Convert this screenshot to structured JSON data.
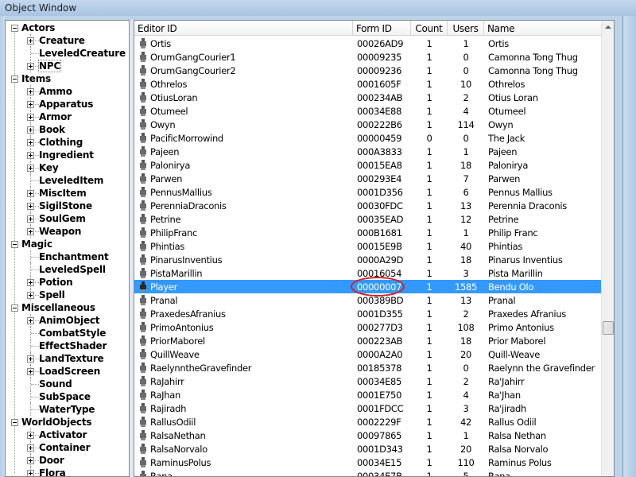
{
  "window": {
    "title": "Object Window"
  },
  "tree": [
    {
      "label": "Actors",
      "level": 0,
      "expander": "minus"
    },
    {
      "label": "Creature",
      "level": 1,
      "expander": "plus"
    },
    {
      "label": "LeveledCreature",
      "level": 1,
      "expander": "none"
    },
    {
      "label": "NPC",
      "level": 1,
      "expander": "plus",
      "selected": true
    },
    {
      "label": "Items",
      "level": 0,
      "expander": "minus"
    },
    {
      "label": "Ammo",
      "level": 1,
      "expander": "plus"
    },
    {
      "label": "Apparatus",
      "level": 1,
      "expander": "plus"
    },
    {
      "label": "Armor",
      "level": 1,
      "expander": "plus"
    },
    {
      "label": "Book",
      "level": 1,
      "expander": "plus"
    },
    {
      "label": "Clothing",
      "level": 1,
      "expander": "plus"
    },
    {
      "label": "Ingredient",
      "level": 1,
      "expander": "plus"
    },
    {
      "label": "Key",
      "level": 1,
      "expander": "plus"
    },
    {
      "label": "LeveledItem",
      "level": 1,
      "expander": "none"
    },
    {
      "label": "MiscItem",
      "level": 1,
      "expander": "plus"
    },
    {
      "label": "SigilStone",
      "level": 1,
      "expander": "plus"
    },
    {
      "label": "SoulGem",
      "level": 1,
      "expander": "plus"
    },
    {
      "label": "Weapon",
      "level": 1,
      "expander": "plus"
    },
    {
      "label": "Magic",
      "level": 0,
      "expander": "minus"
    },
    {
      "label": "Enchantment",
      "level": 1,
      "expander": "none"
    },
    {
      "label": "LeveledSpell",
      "level": 1,
      "expander": "none"
    },
    {
      "label": "Potion",
      "level": 1,
      "expander": "plus"
    },
    {
      "label": "Spell",
      "level": 1,
      "expander": "plus"
    },
    {
      "label": "Miscellaneous",
      "level": 0,
      "expander": "minus"
    },
    {
      "label": "AnimObject",
      "level": 1,
      "expander": "plus"
    },
    {
      "label": "CombatStyle",
      "level": 1,
      "expander": "none"
    },
    {
      "label": "EffectShader",
      "level": 1,
      "expander": "none"
    },
    {
      "label": "LandTexture",
      "level": 1,
      "expander": "plus"
    },
    {
      "label": "LoadScreen",
      "level": 1,
      "expander": "plus"
    },
    {
      "label": "Sound",
      "level": 1,
      "expander": "none"
    },
    {
      "label": "SubSpace",
      "level": 1,
      "expander": "none"
    },
    {
      "label": "WaterType",
      "level": 1,
      "expander": "none"
    },
    {
      "label": "WorldObjects",
      "level": 0,
      "expander": "minus"
    },
    {
      "label": "Activator",
      "level": 1,
      "expander": "plus"
    },
    {
      "label": "Container",
      "level": 1,
      "expander": "plus"
    },
    {
      "label": "Door",
      "level": 1,
      "expander": "plus"
    },
    {
      "label": "Flora",
      "level": 1,
      "expander": "plus"
    }
  ],
  "list": {
    "columns": [
      "Editor ID",
      "Form ID",
      "Count",
      "Users",
      "Name"
    ],
    "rows": [
      {
        "editor_id": "Ortis",
        "form_id": "00026AD9",
        "count": "1",
        "users": "1",
        "name": "Ortis"
      },
      {
        "editor_id": "OrumGangCourier1",
        "form_id": "00009235",
        "count": "1",
        "users": "0",
        "name": "Camonna Tong Thug"
      },
      {
        "editor_id": "OrumGangCourier2",
        "form_id": "00009236",
        "count": "1",
        "users": "0",
        "name": "Camonna Tong Thug"
      },
      {
        "editor_id": "Othrelos",
        "form_id": "0001605F",
        "count": "1",
        "users": "10",
        "name": "Othrelos"
      },
      {
        "editor_id": "OtiusLoran",
        "form_id": "000234AB",
        "count": "1",
        "users": "2",
        "name": "Otius Loran"
      },
      {
        "editor_id": "Otumeel",
        "form_id": "00034E88",
        "count": "1",
        "users": "4",
        "name": "Otumeel"
      },
      {
        "editor_id": "Owyn",
        "form_id": "000222B6",
        "count": "1",
        "users": "114",
        "name": "Owyn"
      },
      {
        "editor_id": "PacificMorrowind",
        "form_id": "00000459",
        "count": "0",
        "users": "0",
        "name": "The Jack"
      },
      {
        "editor_id": "Pajeen",
        "form_id": "000A3833",
        "count": "1",
        "users": "1",
        "name": "Pajeen"
      },
      {
        "editor_id": "Palonirya",
        "form_id": "00015EA8",
        "count": "1",
        "users": "18",
        "name": "Palonirya"
      },
      {
        "editor_id": "Parwen",
        "form_id": "000293E4",
        "count": "1",
        "users": "7",
        "name": "Parwen"
      },
      {
        "editor_id": "PennusMallius",
        "form_id": "0001D356",
        "count": "1",
        "users": "6",
        "name": "Pennus Mallius"
      },
      {
        "editor_id": "PerenniaDraconis",
        "form_id": "00030FDC",
        "count": "1",
        "users": "13",
        "name": "Perennia Draconis"
      },
      {
        "editor_id": "Petrine",
        "form_id": "00035EAD",
        "count": "1",
        "users": "12",
        "name": "Petrine"
      },
      {
        "editor_id": "PhilipFranc",
        "form_id": "000B1681",
        "count": "1",
        "users": "1",
        "name": "Philip Franc"
      },
      {
        "editor_id": "Phintias",
        "form_id": "00015E9B",
        "count": "1",
        "users": "40",
        "name": "Phintias"
      },
      {
        "editor_id": "PinarusInventius",
        "form_id": "0000A29D",
        "count": "1",
        "users": "18",
        "name": "Pinarus Inventius"
      },
      {
        "editor_id": "PistaMarillin",
        "form_id": "00016054",
        "count": "1",
        "users": "3",
        "name": "Pista Marillin"
      },
      {
        "editor_id": "Player",
        "form_id": "00000007",
        "count": "1",
        "users": "1585",
        "name": "Bendu Olo",
        "selected": true
      },
      {
        "editor_id": "Pranal",
        "form_id": "000389BD",
        "count": "1",
        "users": "13",
        "name": "Pranal"
      },
      {
        "editor_id": "PraxedesAfranius",
        "form_id": "0001D355",
        "count": "1",
        "users": "2",
        "name": "Praxedes Afranius"
      },
      {
        "editor_id": "PrimoAntonius",
        "form_id": "000277D3",
        "count": "1",
        "users": "108",
        "name": "Primo Antonius"
      },
      {
        "editor_id": "PriorMaborel",
        "form_id": "000223AB",
        "count": "1",
        "users": "18",
        "name": "Prior Maborel"
      },
      {
        "editor_id": "QuillWeave",
        "form_id": "0000A2A0",
        "count": "1",
        "users": "20",
        "name": "Quill-Weave"
      },
      {
        "editor_id": "RaelynntheGravefinder",
        "form_id": "00185378",
        "count": "1",
        "users": "0",
        "name": "Raelynn the Gravefinder"
      },
      {
        "editor_id": "RaJahirr",
        "form_id": "00034E85",
        "count": "1",
        "users": "2",
        "name": "Ra'Jahirr"
      },
      {
        "editor_id": "RaJhan",
        "form_id": "0001E750",
        "count": "1",
        "users": "4",
        "name": "Ra'Jhan"
      },
      {
        "editor_id": "Rajiradh",
        "form_id": "0001FDCC",
        "count": "1",
        "users": "3",
        "name": "Ra'jiradh"
      },
      {
        "editor_id": "RallusOdiil",
        "form_id": "0002229F",
        "count": "1",
        "users": "42",
        "name": "Rallus Odiil"
      },
      {
        "editor_id": "RalsaNethan",
        "form_id": "00097865",
        "count": "1",
        "users": "1",
        "name": "Ralsa Nethan"
      },
      {
        "editor_id": "RalsaNorvalo",
        "form_id": "0001D343",
        "count": "1",
        "users": "20",
        "name": "Ralsa Norvalo"
      },
      {
        "editor_id": "RaminusPolus",
        "form_id": "00034E15",
        "count": "1",
        "users": "110",
        "name": "Raminus Polus"
      },
      {
        "editor_id": "Rana",
        "form_id": "00034E7B",
        "count": "1",
        "users": "5",
        "name": "Rana"
      }
    ]
  },
  "icons": {
    "row_icon": "npc-icon",
    "expander_icon": "tree-expander-icon",
    "scroll_up": "scroll-up-arrow-icon"
  },
  "colors": {
    "selection": "#3399ff",
    "annotation": "#d8211f"
  }
}
